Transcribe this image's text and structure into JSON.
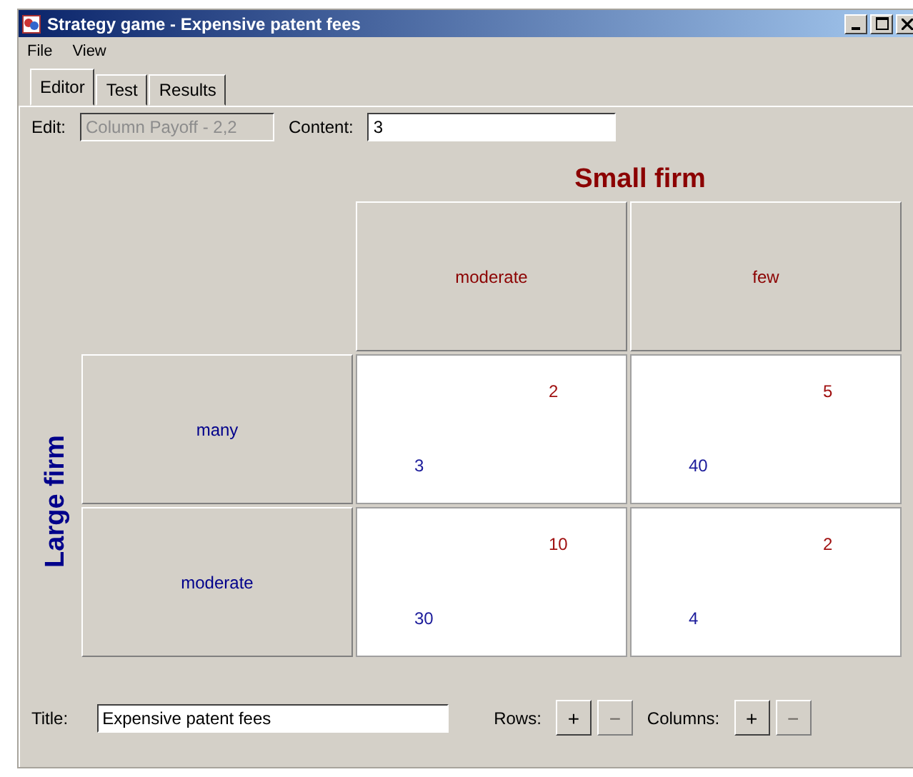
{
  "window": {
    "title": "Strategy game - Expensive patent fees"
  },
  "menu": [
    "File",
    "View"
  ],
  "tabs": [
    {
      "label": "Editor",
      "selected": true
    },
    {
      "label": "Test",
      "selected": false
    },
    {
      "label": "Results",
      "selected": false
    }
  ],
  "edit": {
    "label": "Edit:",
    "value": "Column Payoff - 2,2",
    "disabled": true
  },
  "content": {
    "label": "Content:",
    "value": "3"
  },
  "game": {
    "column_player": "Small firm",
    "row_player": "Large firm",
    "columns": [
      "moderate",
      "few"
    ],
    "rows": [
      {
        "label": "many",
        "cells": [
          {
            "column_payoff": "2",
            "row_payoff": "3"
          },
          {
            "column_payoff": "5",
            "row_payoff": "40"
          }
        ]
      },
      {
        "label": "moderate",
        "cells": [
          {
            "column_payoff": "10",
            "row_payoff": "30"
          },
          {
            "column_payoff": "2",
            "row_payoff": "4"
          }
        ]
      }
    ]
  },
  "footer": {
    "title_label": "Title:",
    "title_value": "Expensive patent fees",
    "rows_label": "Rows:",
    "columns_label": "Columns:",
    "row_buttons": [
      {
        "label": "+",
        "disabled": false
      },
      {
        "label": "−",
        "disabled": true
      }
    ],
    "column_buttons": [
      {
        "label": "+",
        "disabled": false
      },
      {
        "label": "−",
        "disabled": true
      }
    ]
  }
}
